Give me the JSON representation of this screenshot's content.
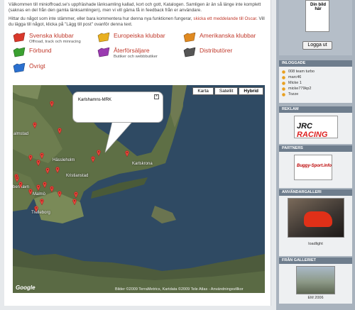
{
  "intro": {
    "line1": "Välkommen till minioffroad.se's uppfräshade länksamling kallad, kort och gott, Katalogen. Samligen är än så länge inte komplett (saknas en del från den gamla länksamlingen), men vi vill gärna få in feedback från er användare.",
    "line2a": "Hittar du något som inte stämmer, eller bara kommentera hur denna nya funktionen fungerar, ",
    "line2_link": "skicka ett meddelande till Oscar",
    "line2b": ". Vill du lägga till något, klicka på \"Lägg till post\" ovanför denna text."
  },
  "categories": [
    {
      "title": "Svenska klubbar",
      "sub": "Offroad, track och minracing",
      "color": "#d9382b"
    },
    {
      "title": "Europeiska klubbar",
      "sub": "",
      "color": "#e8b020"
    },
    {
      "title": "Amerikanska klubbar",
      "sub": "",
      "color": "#e08a20"
    },
    {
      "title": "Förbund",
      "sub": "",
      "color": "#3aa030"
    },
    {
      "title": "Återförsäljare",
      "sub": "Butiker och webbbutiker",
      "color": "#9a3ab0"
    },
    {
      "title": "Distributörer",
      "sub": "",
      "color": "#555555"
    },
    {
      "title": "Övrigt",
      "sub": "",
      "color": "#2a70d0"
    }
  ],
  "map": {
    "buttons": [
      "Karta",
      "Satellit",
      "Hybrid"
    ],
    "active_button": "Hybrid",
    "info_title": "Karlshamns-MRK",
    "close_glyph": "×",
    "labels": [
      "almstad",
      "Hässleholm",
      "Kristianstad",
      "Karlskrona",
      "benhavn",
      "Malmö",
      "Trelleborg"
    ],
    "attribution": "Bilder ©2009 TerraMetrics, Kartdata ©2009 Tele Atlas - Användningsvillkor",
    "logo": "Google"
  },
  "sidebar": {
    "login_image_text": "Din bild här",
    "login_button": "Logga ut",
    "online_title": "INLOGGADE",
    "online_users": [
      "008 team turbo",
      "marc46",
      "Micke 1",
      "micke779kp2",
      "Tozze"
    ],
    "ad_title": "REKLAM",
    "ad_logo_a": "JRC",
    "ad_logo_b": "RACING",
    "partners_title": "PARTNERS",
    "partner_logo": "Buggy-Sport.info",
    "gallery_title": "ANVÄNDARGALLERI",
    "gallery_caption": "loadlight",
    "latest_title": "FRÅN GALLERIET",
    "latest_caption": "EM 2006"
  }
}
